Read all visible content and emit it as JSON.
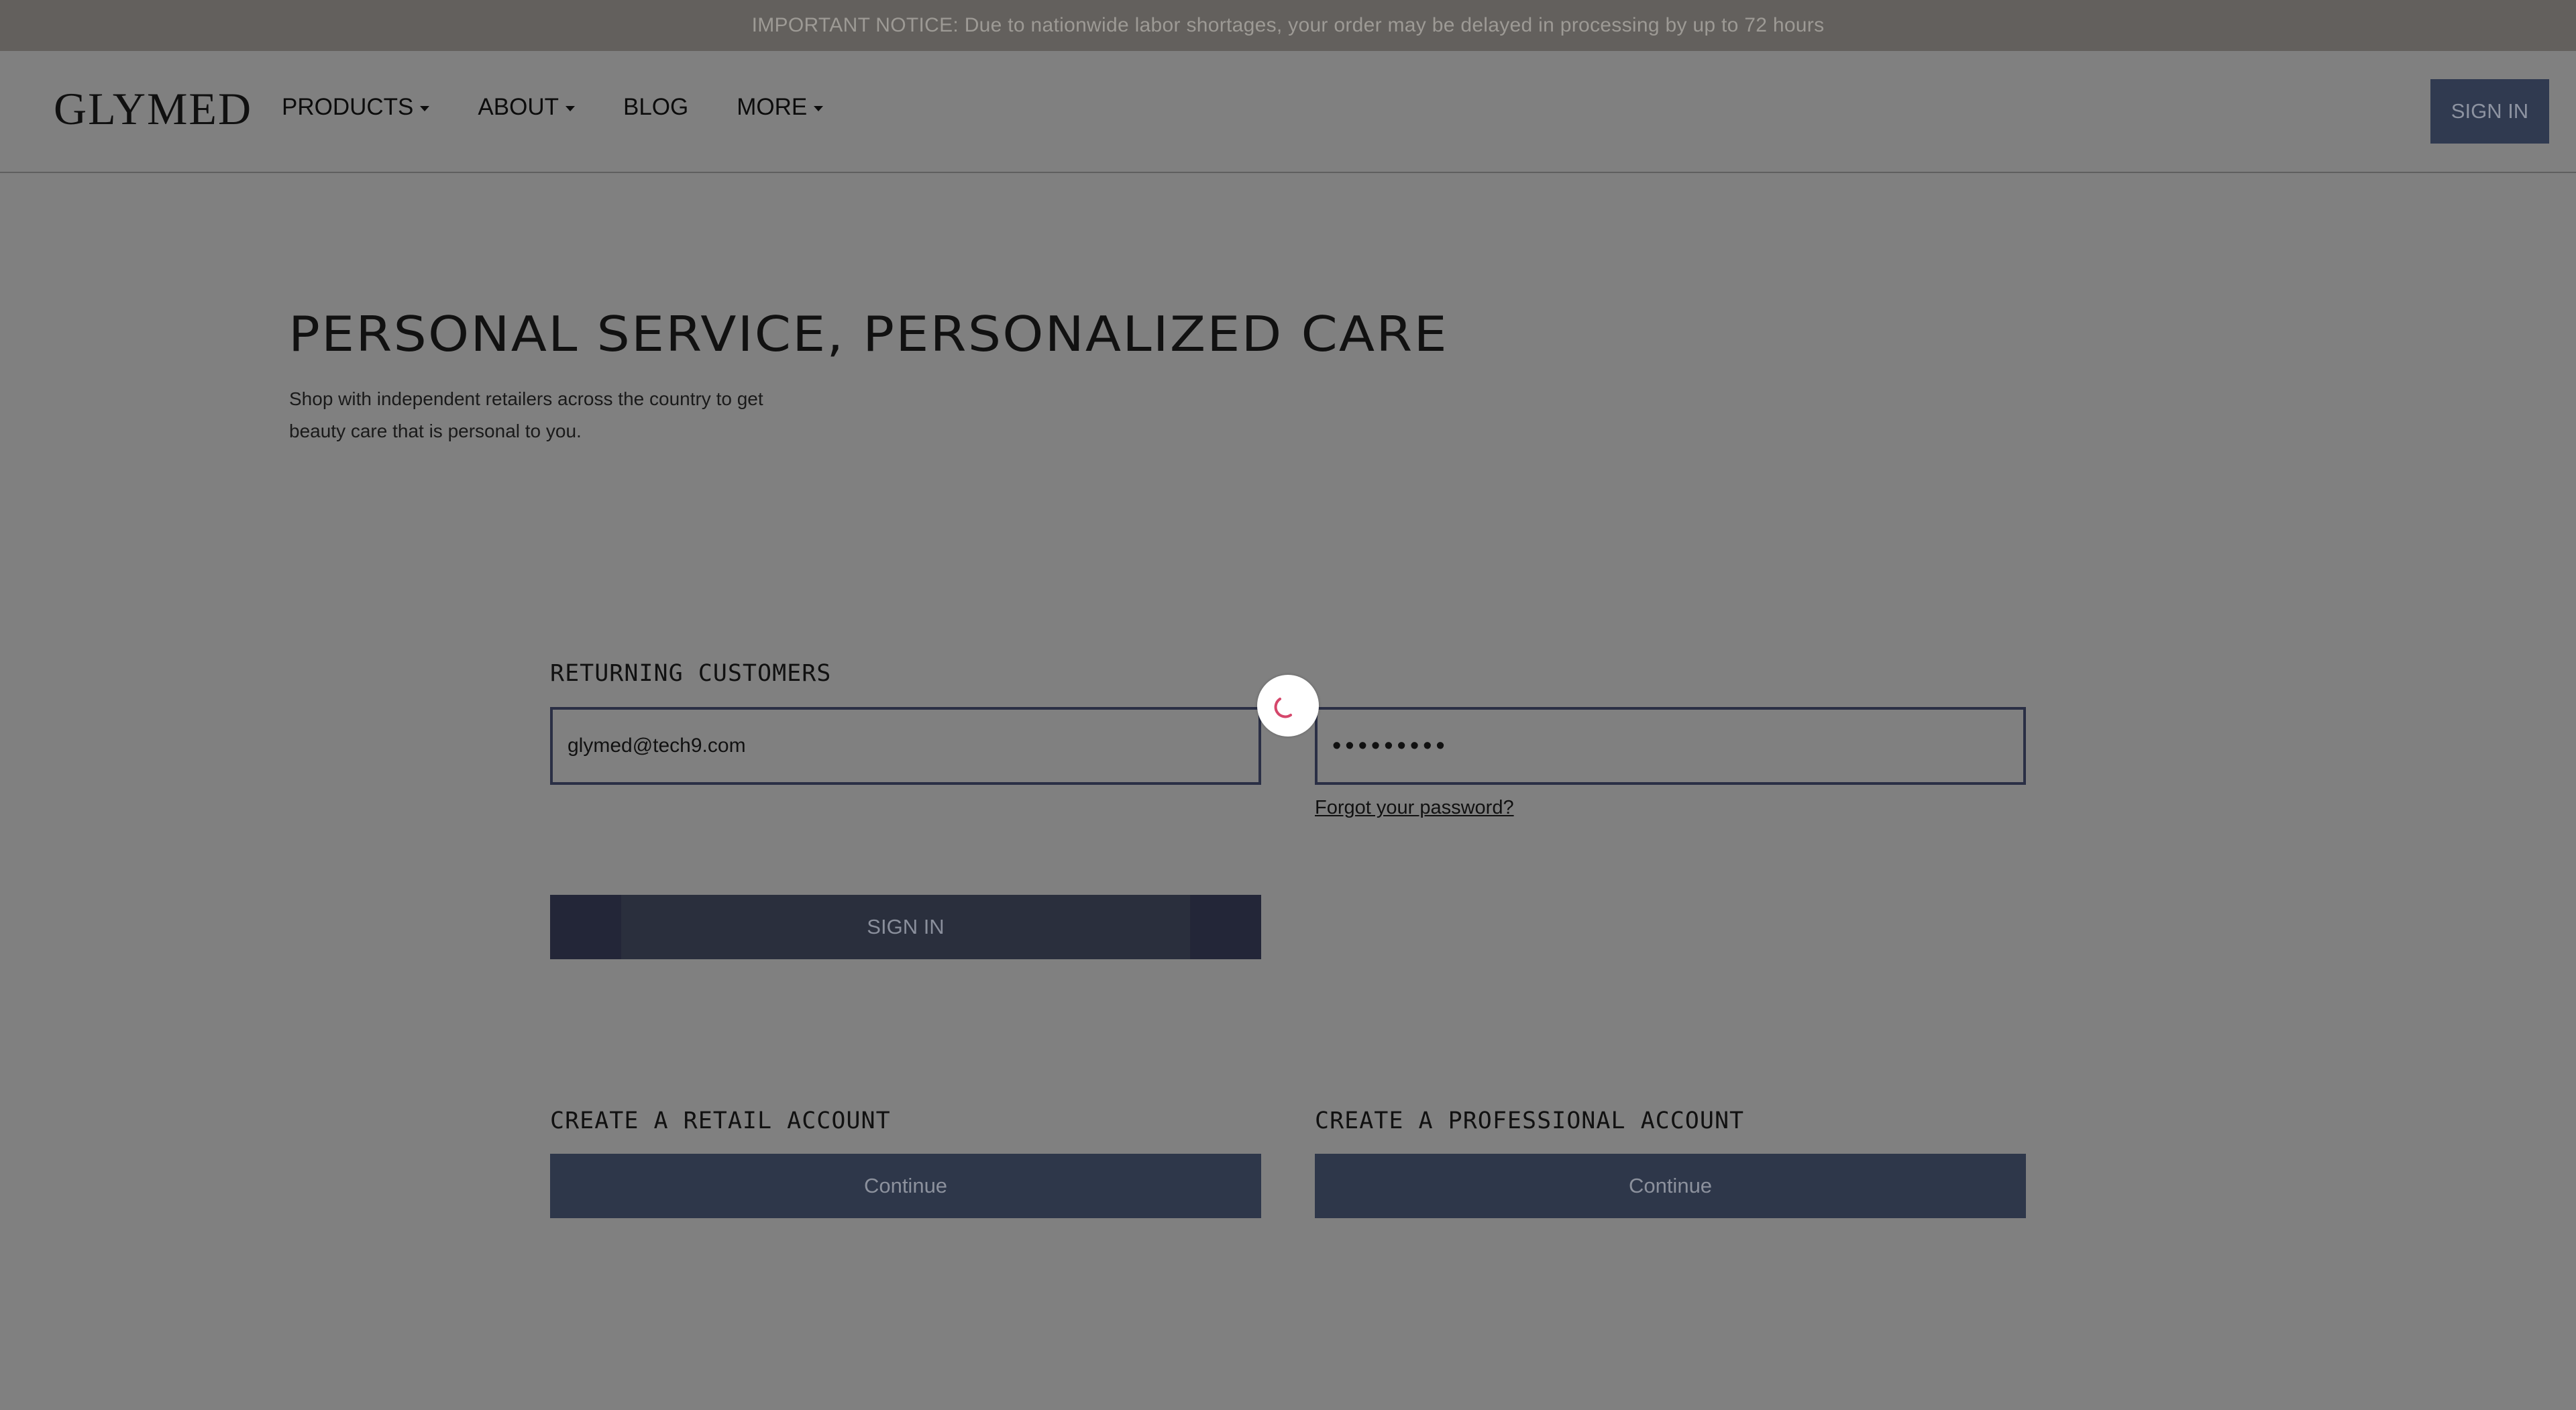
{
  "notice": {
    "text": "IMPORTANT NOTICE: Due to nationwide labor shortages, your order may be delayed in processing by up to 72 hours"
  },
  "header": {
    "logo": "GLYMED",
    "nav": [
      {
        "label": "PRODUCTS",
        "has_dropdown": true
      },
      {
        "label": "ABOUT",
        "has_dropdown": true
      },
      {
        "label": "BLOG",
        "has_dropdown": false
      },
      {
        "label": "MORE",
        "has_dropdown": true
      }
    ],
    "sign_in_label": "SIGN IN"
  },
  "hero": {
    "title": "PERSONAL SERVICE, PERSONALIZED CARE",
    "subtitle_line1": "Shop with independent retailers across the country to get",
    "subtitle_line2": "beauty care that is personal to you."
  },
  "login": {
    "heading": "RETURNING CUSTOMERS",
    "email_value": "glymed@tech9.com",
    "password_value": "•••••••••",
    "forgot_label": "Forgot your password?",
    "sign_in_label": "SIGN IN",
    "loading": true
  },
  "accounts": {
    "retail_heading": "CREATE A RETAIL ACCOUNT",
    "retail_button": "Continue",
    "professional_heading": "CREATE A PROFESSIONAL ACCOUNT",
    "professional_button": "Continue"
  },
  "colors": {
    "overlay_bg": "#808080",
    "notice_bg": "#63605d",
    "button_bg": "#2e374a",
    "spinner_accent": "#d5476b"
  }
}
